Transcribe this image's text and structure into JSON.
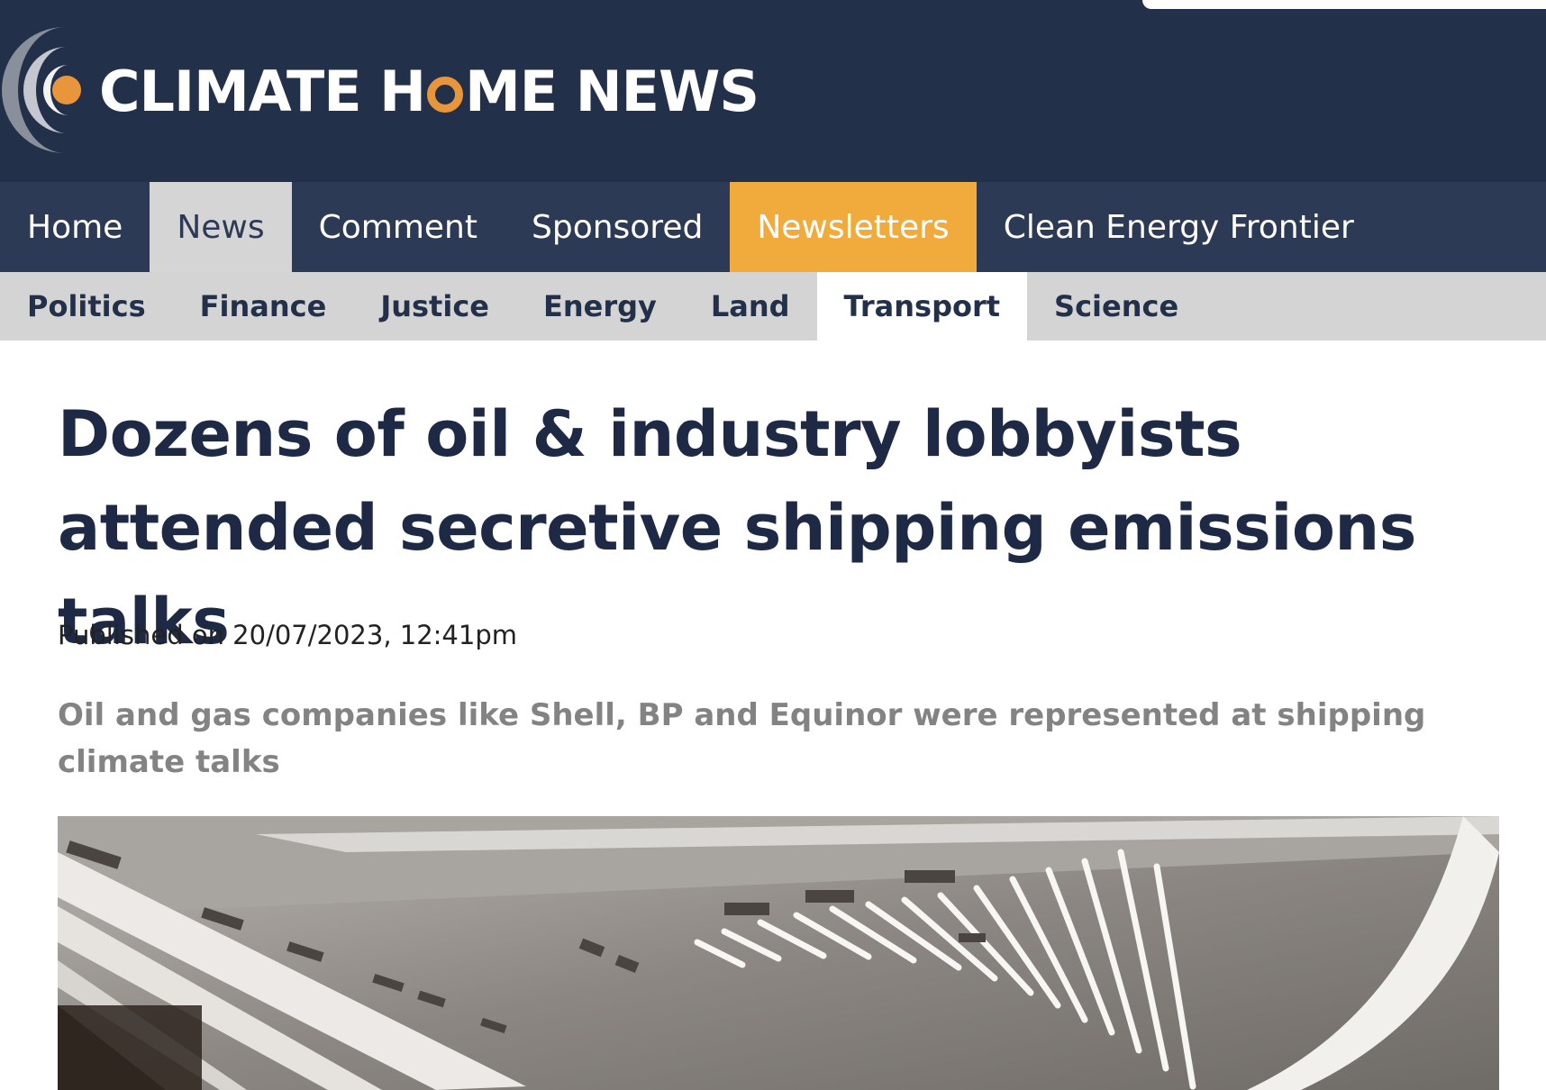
{
  "site": {
    "logo_text_before": "CLIMATE H",
    "logo_text_after": "ME NEWS",
    "accent_color": "#e8953b",
    "header_color": "#23304a"
  },
  "nav_primary": {
    "items": [
      {
        "label": "Home"
      },
      {
        "label": "News",
        "state": "active"
      },
      {
        "label": "Comment"
      },
      {
        "label": "Sponsored"
      },
      {
        "label": "Newsletters",
        "state": "highlighted",
        "color": "#f0ab3c"
      },
      {
        "label": "Clean Energy Frontier"
      }
    ]
  },
  "nav_secondary": {
    "items": [
      {
        "label": "Politics"
      },
      {
        "label": "Finance"
      },
      {
        "label": "Justice"
      },
      {
        "label": "Energy"
      },
      {
        "label": "Land"
      },
      {
        "label": "Transport",
        "state": "active"
      },
      {
        "label": "Science"
      }
    ]
  },
  "article": {
    "headline": "Dozens of oil & industry lobbyists attended secretive shipping emissions talks",
    "published": "Published on 20/07/2023, 12:41pm",
    "standfirst": "Oil and gas companies like Shell, BP and Equinor were represented at shipping climate talks"
  }
}
